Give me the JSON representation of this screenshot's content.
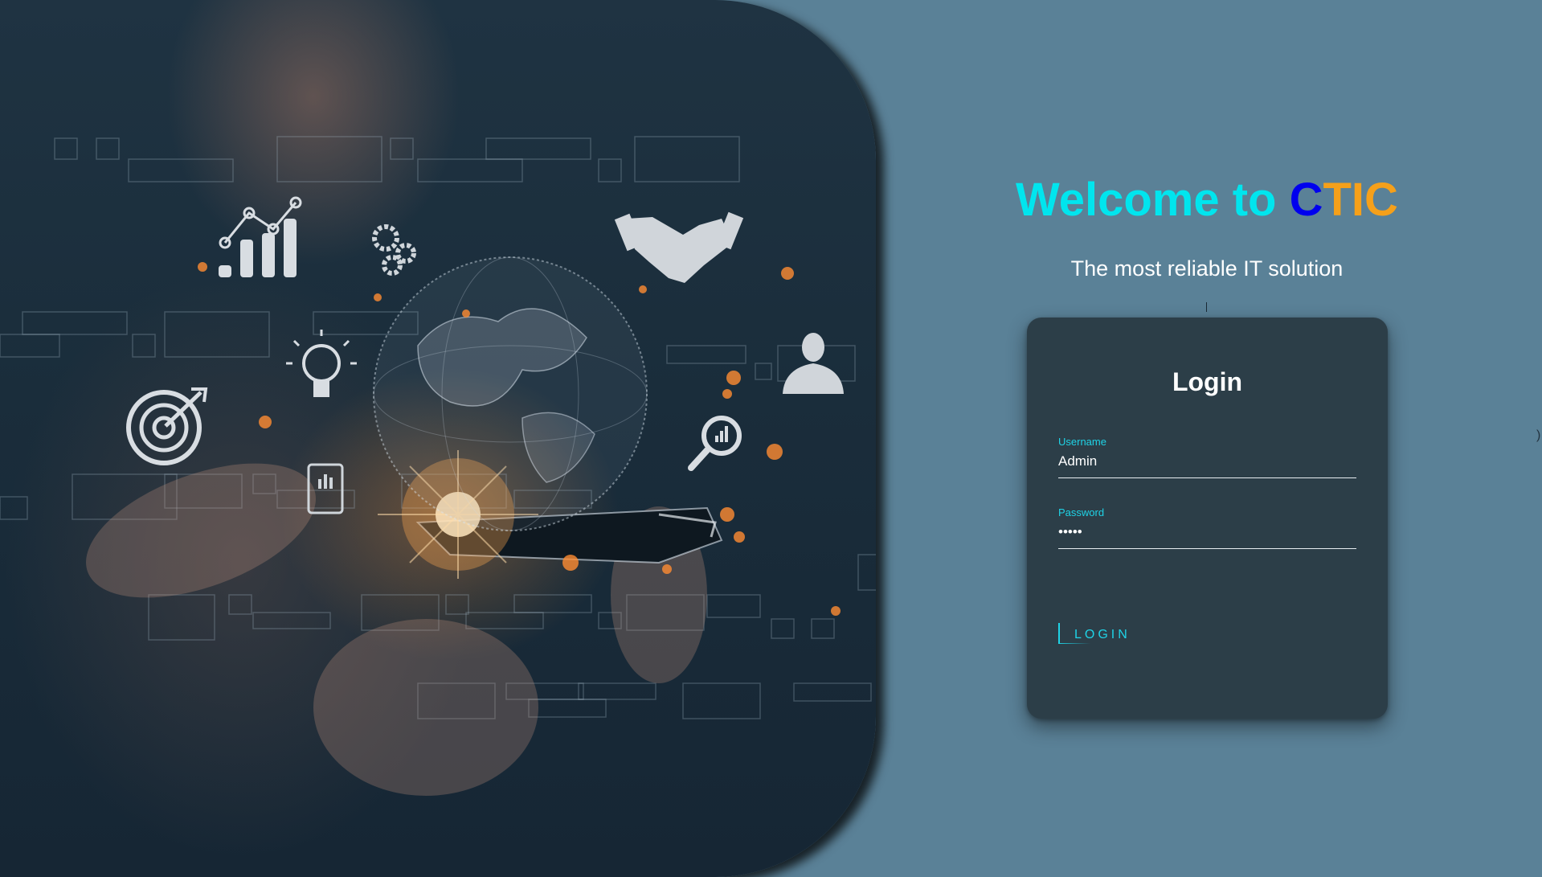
{
  "hero": {
    "image_description_icons": [
      "line-chart-icon",
      "gears-icon",
      "handshake-icon",
      "lightbulb-icon",
      "businessman-icon",
      "target-icon",
      "magnifier-chart-icon",
      "clipboard-chart-icon",
      "globe-icon",
      "smartphone-icon"
    ]
  },
  "welcome": {
    "prefix": "Welcome to ",
    "brand_first": "C",
    "brand_rest": "TIC"
  },
  "tagline": "The most reliable IT solution",
  "edge_mark": ")",
  "login": {
    "title": "Login",
    "username": {
      "label": "Username",
      "value": "Admin"
    },
    "password": {
      "label": "Password",
      "value": "•••••"
    },
    "button_label": "LOGIN"
  },
  "colors": {
    "page_background": "#5a8197",
    "card_background": "#2c3e48",
    "accent_cyan": "#00e5ee",
    "brand_blue": "#0000ee",
    "brand_orange": "#f5a01a",
    "field_label": "#1fd3e6"
  }
}
